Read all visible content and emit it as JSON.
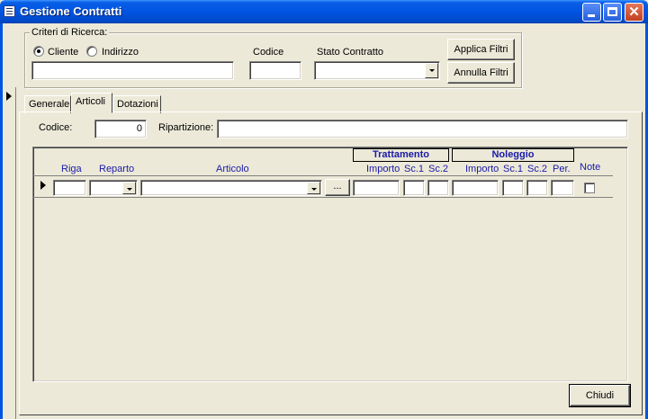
{
  "window": {
    "title": "Gestione Contratti"
  },
  "criteria": {
    "legend": "Criteri di Ricerca:",
    "radio_cliente": "Cliente",
    "radio_indirizzo": "Indirizzo",
    "codice_label": "Codice",
    "stato_label": "Stato Contratto",
    "applica_label": "Applica Filtri",
    "annulla_label": "Annulla Filtri"
  },
  "tabs": [
    "Generale",
    "Articoli",
    "Dotazioni"
  ],
  "articoli": {
    "codice_label": "Codice:",
    "codice_value": "0",
    "ripartizione_label": "Ripartizione:",
    "group_trattamento": "Trattamento",
    "group_noleggio": "Noleggio",
    "columns": {
      "riga": "Riga",
      "reparto": "Reparto",
      "articolo": "Articolo",
      "t_importo": "Importo",
      "t_sc1": "Sc.1",
      "t_sc2": "Sc.2",
      "n_importo": "Importo",
      "n_sc1": "Sc.1",
      "n_sc2": "Sc.2",
      "n_per": "Per.",
      "note": "Note"
    },
    "ellipsis_label": "..."
  },
  "footer": {
    "chiudi_label": "Chiudi"
  }
}
